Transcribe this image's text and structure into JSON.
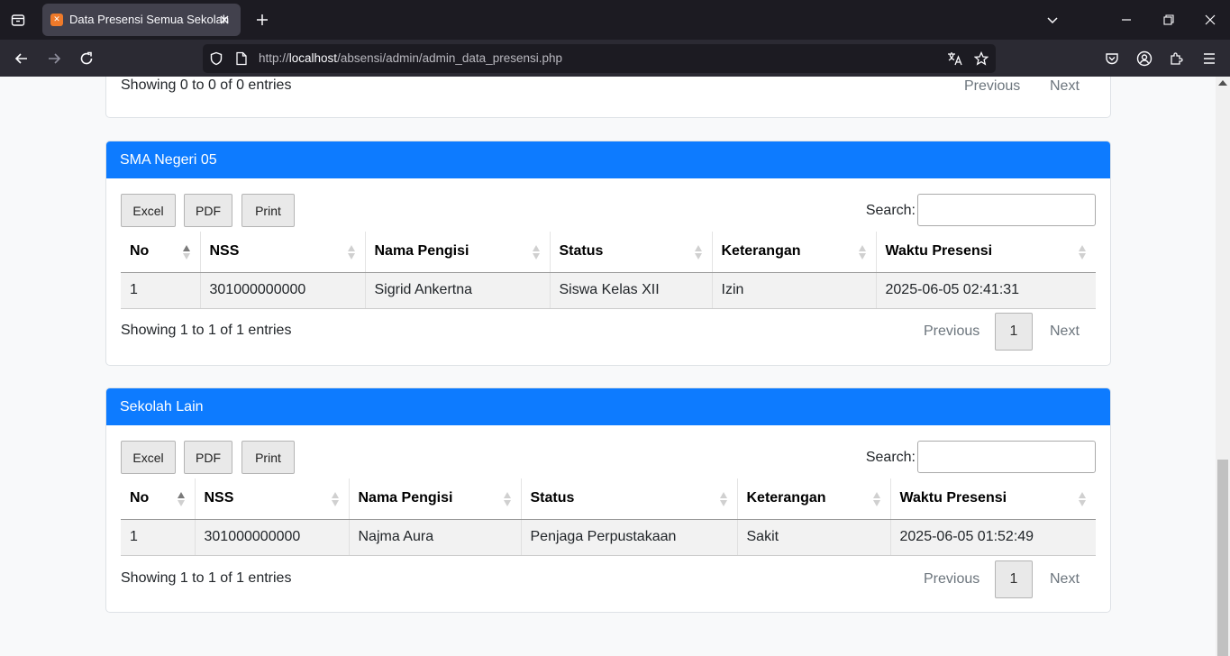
{
  "browser": {
    "tab_title": "Data Presensi Semua Sekolah",
    "url_prefix": "http://",
    "url_host": "localhost",
    "url_path": "/absensi/admin/admin_data_presensi.php"
  },
  "prev_section": {
    "info": "Showing 0 to 0 of 0 entries",
    "previous": "Previous",
    "next": "Next"
  },
  "sections": [
    {
      "title": "SMA Negeri 05",
      "buttons": [
        "Excel",
        "PDF",
        "Print"
      ],
      "search_label": "Search:",
      "search_value": "",
      "columns": [
        "No",
        "NSS",
        "Nama Pengisi",
        "Status",
        "Keterangan",
        "Waktu Presensi"
      ],
      "rows": [
        [
          "1",
          "301000000000",
          "Sigrid Ankertna",
          "Siswa Kelas XII",
          "Izin",
          "2025-06-05 02:41:31"
        ]
      ],
      "info": "Showing 1 to 1 of 1 entries",
      "previous": "Previous",
      "page": "1",
      "next": "Next"
    },
    {
      "title": "Sekolah Lain",
      "buttons": [
        "Excel",
        "PDF",
        "Print"
      ],
      "search_label": "Search:",
      "search_value": "",
      "columns": [
        "No",
        "NSS",
        "Nama Pengisi",
        "Status",
        "Keterangan",
        "Waktu Presensi"
      ],
      "rows": [
        [
          "1",
          "301000000000",
          "Najma Aura",
          "Penjaga Perpustakaan",
          "Sakit",
          "2025-06-05 01:52:49"
        ]
      ],
      "info": "Showing 1 to 1 of 1 entries",
      "previous": "Previous",
      "page": "1",
      "next": "Next"
    }
  ],
  "colors": {
    "card_header": "#0d7bff",
    "chrome_dark": "#1c1b22"
  }
}
